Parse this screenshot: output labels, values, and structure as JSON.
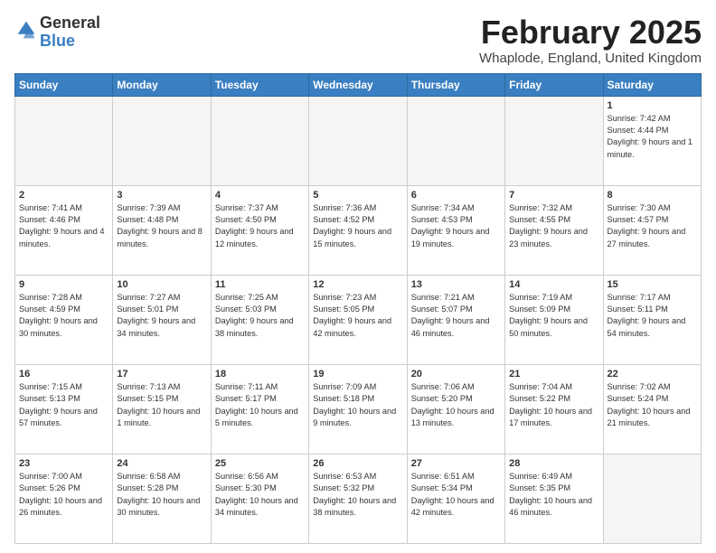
{
  "logo": {
    "general": "General",
    "blue": "Blue"
  },
  "header": {
    "month": "February 2025",
    "location": "Whaplode, England, United Kingdom"
  },
  "days_of_week": [
    "Sunday",
    "Monday",
    "Tuesday",
    "Wednesday",
    "Thursday",
    "Friday",
    "Saturday"
  ],
  "weeks": [
    [
      {
        "day": "",
        "info": ""
      },
      {
        "day": "",
        "info": ""
      },
      {
        "day": "",
        "info": ""
      },
      {
        "day": "",
        "info": ""
      },
      {
        "day": "",
        "info": ""
      },
      {
        "day": "",
        "info": ""
      },
      {
        "day": "1",
        "info": "Sunrise: 7:42 AM\nSunset: 4:44 PM\nDaylight: 9 hours and 1 minute."
      }
    ],
    [
      {
        "day": "2",
        "info": "Sunrise: 7:41 AM\nSunset: 4:46 PM\nDaylight: 9 hours and 4 minutes."
      },
      {
        "day": "3",
        "info": "Sunrise: 7:39 AM\nSunset: 4:48 PM\nDaylight: 9 hours and 8 minutes."
      },
      {
        "day": "4",
        "info": "Sunrise: 7:37 AM\nSunset: 4:50 PM\nDaylight: 9 hours and 12 minutes."
      },
      {
        "day": "5",
        "info": "Sunrise: 7:36 AM\nSunset: 4:52 PM\nDaylight: 9 hours and 15 minutes."
      },
      {
        "day": "6",
        "info": "Sunrise: 7:34 AM\nSunset: 4:53 PM\nDaylight: 9 hours and 19 minutes."
      },
      {
        "day": "7",
        "info": "Sunrise: 7:32 AM\nSunset: 4:55 PM\nDaylight: 9 hours and 23 minutes."
      },
      {
        "day": "8",
        "info": "Sunrise: 7:30 AM\nSunset: 4:57 PM\nDaylight: 9 hours and 27 minutes."
      }
    ],
    [
      {
        "day": "9",
        "info": "Sunrise: 7:28 AM\nSunset: 4:59 PM\nDaylight: 9 hours and 30 minutes."
      },
      {
        "day": "10",
        "info": "Sunrise: 7:27 AM\nSunset: 5:01 PM\nDaylight: 9 hours and 34 minutes."
      },
      {
        "day": "11",
        "info": "Sunrise: 7:25 AM\nSunset: 5:03 PM\nDaylight: 9 hours and 38 minutes."
      },
      {
        "day": "12",
        "info": "Sunrise: 7:23 AM\nSunset: 5:05 PM\nDaylight: 9 hours and 42 minutes."
      },
      {
        "day": "13",
        "info": "Sunrise: 7:21 AM\nSunset: 5:07 PM\nDaylight: 9 hours and 46 minutes."
      },
      {
        "day": "14",
        "info": "Sunrise: 7:19 AM\nSunset: 5:09 PM\nDaylight: 9 hours and 50 minutes."
      },
      {
        "day": "15",
        "info": "Sunrise: 7:17 AM\nSunset: 5:11 PM\nDaylight: 9 hours and 54 minutes."
      }
    ],
    [
      {
        "day": "16",
        "info": "Sunrise: 7:15 AM\nSunset: 5:13 PM\nDaylight: 9 hours and 57 minutes."
      },
      {
        "day": "17",
        "info": "Sunrise: 7:13 AM\nSunset: 5:15 PM\nDaylight: 10 hours and 1 minute."
      },
      {
        "day": "18",
        "info": "Sunrise: 7:11 AM\nSunset: 5:17 PM\nDaylight: 10 hours and 5 minutes."
      },
      {
        "day": "19",
        "info": "Sunrise: 7:09 AM\nSunset: 5:18 PM\nDaylight: 10 hours and 9 minutes."
      },
      {
        "day": "20",
        "info": "Sunrise: 7:06 AM\nSunset: 5:20 PM\nDaylight: 10 hours and 13 minutes."
      },
      {
        "day": "21",
        "info": "Sunrise: 7:04 AM\nSunset: 5:22 PM\nDaylight: 10 hours and 17 minutes."
      },
      {
        "day": "22",
        "info": "Sunrise: 7:02 AM\nSunset: 5:24 PM\nDaylight: 10 hours and 21 minutes."
      }
    ],
    [
      {
        "day": "23",
        "info": "Sunrise: 7:00 AM\nSunset: 5:26 PM\nDaylight: 10 hours and 26 minutes."
      },
      {
        "day": "24",
        "info": "Sunrise: 6:58 AM\nSunset: 5:28 PM\nDaylight: 10 hours and 30 minutes."
      },
      {
        "day": "25",
        "info": "Sunrise: 6:56 AM\nSunset: 5:30 PM\nDaylight: 10 hours and 34 minutes."
      },
      {
        "day": "26",
        "info": "Sunrise: 6:53 AM\nSunset: 5:32 PM\nDaylight: 10 hours and 38 minutes."
      },
      {
        "day": "27",
        "info": "Sunrise: 6:51 AM\nSunset: 5:34 PM\nDaylight: 10 hours and 42 minutes."
      },
      {
        "day": "28",
        "info": "Sunrise: 6:49 AM\nSunset: 5:35 PM\nDaylight: 10 hours and 46 minutes."
      },
      {
        "day": "",
        "info": ""
      }
    ]
  ]
}
